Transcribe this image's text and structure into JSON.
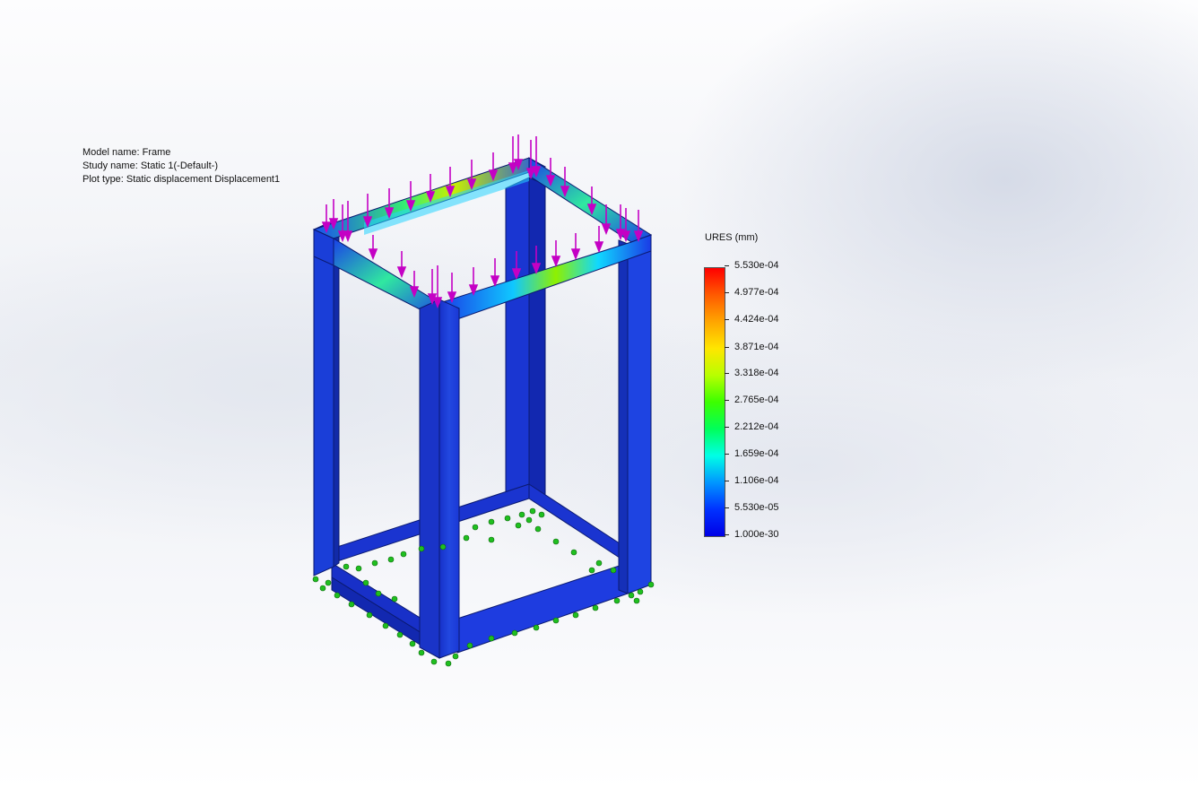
{
  "plot_info": {
    "model_name": "Model name: Frame",
    "study_name": "Study name: Static 1(-Default-)",
    "plot_type": "Plot type: Static displacement Displacement1"
  },
  "legend": {
    "title": "URES (mm)",
    "ticks": [
      "5.530e-04",
      "4.977e-04",
      "4.424e-04",
      "3.871e-04",
      "3.318e-04",
      "2.765e-04",
      "2.212e-04",
      "1.659e-04",
      "1.106e-04",
      "5.530e-05",
      "1.000e-30"
    ]
  },
  "colors": {
    "frame_blue": "#1a2fd8",
    "load_arrow": "#c400c4",
    "fixture": "#1fbf1f"
  }
}
